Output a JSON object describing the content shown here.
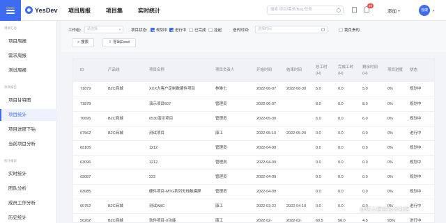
{
  "app": {
    "brand": "YesDev"
  },
  "header": {
    "nav": [
      "项目周报",
      "项目集",
      "实时统计"
    ],
    "search_placeholder": "搜索 项目/需求/Bug/任务",
    "notification_count": "29",
    "add_label": "添加 +",
    "user_initials": "曾康"
  },
  "sidebar": {
    "groups": [
      "项目汇总",
      "项目报告",
      "统计报表"
    ],
    "items": [
      {
        "label": "项目周报",
        "active": false
      },
      {
        "label": "需求周报",
        "active": false
      },
      {
        "label": "测试周报",
        "active": false
      },
      {
        "label": "项目甘特图",
        "active": false
      },
      {
        "label": "项目统计",
        "active": true
      },
      {
        "label": "项目进度下钻",
        "active": false
      },
      {
        "label": "当前项目分析",
        "active": false
      },
      {
        "label": "实时统计",
        "active": false
      },
      {
        "label": "团队分析",
        "active": false
      },
      {
        "label": "成员工作分析",
        "active": false
      },
      {
        "label": "历史统计",
        "active": false
      }
    ]
  },
  "filters": {
    "workspace_label": "工作组:",
    "workspace_placeholder": "请选择",
    "status_label": "项目状态:",
    "statuses": [
      {
        "label": "规划中",
        "checked": true
      },
      {
        "label": "进行中",
        "checked": true
      },
      {
        "label": "已完成",
        "checked": false
      },
      {
        "label": "挂起",
        "checked": false
      }
    ],
    "date_label": "迭代时间:",
    "date_placeholder": "选择时间",
    "mine_label": "我负责的",
    "search_button": "搜索",
    "export_button": "导出Excel"
  },
  "table": {
    "columns": [
      "ID",
      "产品线",
      "项目名称",
      "项目负责人",
      "开始时间",
      "结束时间",
      "总工时(H)",
      "完成工时(H)",
      "剩余时间(H)",
      "项目进度",
      "状态"
    ],
    "rows": [
      [
        "71879",
        "B2C商城",
        "XXX大客户定制数硬件项目",
        "林琳七",
        "2022-06-07",
        "2022-06-30",
        "5.0",
        "0.0",
        "5.0",
        "0%",
        "规划中"
      ],
      [
        "71878",
        "",
        "演示项目607",
        "管理员",
        "2022-06-07",
        "",
        "8.0",
        "0.0",
        "8.0",
        "0%",
        "规划中"
      ],
      [
        "70695",
        "B2C商城",
        "0530演示项目",
        "管理员",
        "2022-05-30",
        "",
        "6.0",
        "0.0",
        "6.0",
        "0%",
        "规划中"
      ],
      [
        "67562",
        "B2C商城",
        "测试项目",
        "康工",
        "2022-05-10",
        "2022-05-20",
        "0.0",
        "0.0",
        "0.0",
        "0%",
        "进行中"
      ],
      [
        "63105",
        "",
        "1212",
        "管理员",
        "2022-04-09",
        "",
        "0.0",
        "0.0",
        "0.0",
        "0%",
        "规划中"
      ],
      [
        "63096",
        "",
        "1212",
        "管理员",
        "2022-04-09",
        "",
        "0.0",
        "0.0",
        "0.0",
        "0%",
        "规划中"
      ],
      [
        "63087",
        "",
        "222",
        "管理员",
        "2022-04-09",
        "",
        "0.0",
        "0.0",
        "0.0",
        "0%",
        "规划中"
      ],
      [
        "63085",
        "",
        "硬件项目-MTG系列无线触摸屏",
        "管理员",
        "2022-04-09",
        "",
        "0.0",
        "0.0",
        "0.0",
        "0%",
        "规划中"
      ],
      [
        "60752",
        "B2C商城",
        "测试ABC",
        "康工",
        "2022-03-22",
        "2022-04-19",
        "0.0",
        "0.0",
        "0.0",
        "0%",
        "进行中"
      ],
      [
        "56262",
        "B2C商城",
        "软件项目-X功能",
        "康工",
        "2022-02-",
        "2022-02-",
        "60.5",
        "56.0",
        "4.5",
        "93%",
        "进行中"
      ]
    ]
  },
  "watermark": "@稀土掘金技术社区"
}
